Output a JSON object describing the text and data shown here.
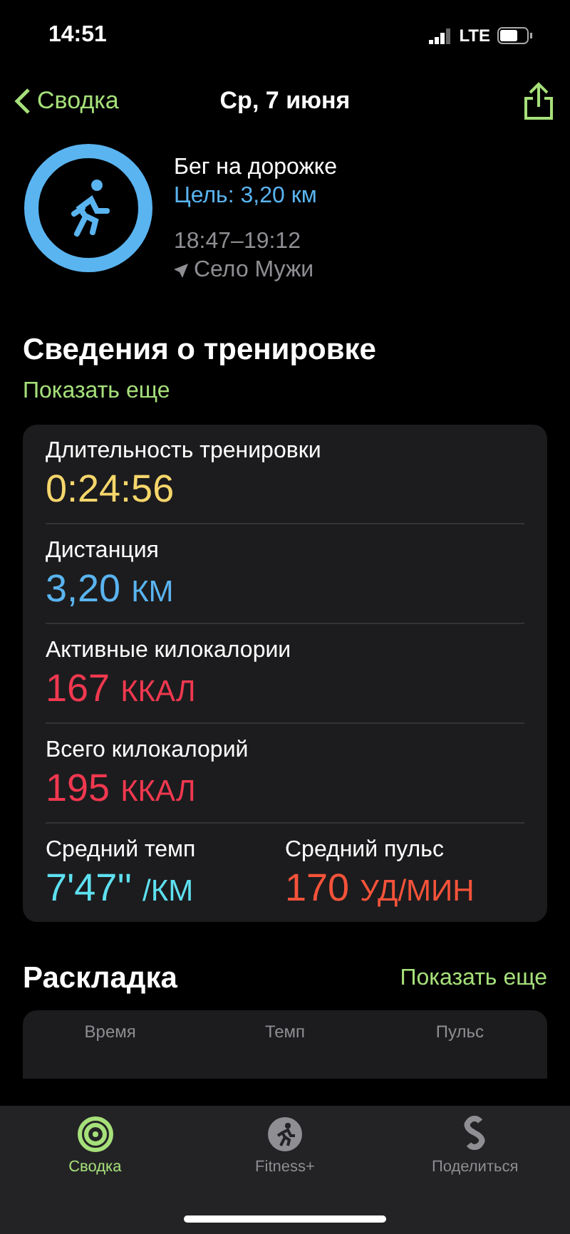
{
  "status_bar": {
    "time": "14:51",
    "network": "LTE"
  },
  "nav": {
    "back": "Сводка",
    "title": "Ср, 7 июня"
  },
  "workout": {
    "name": "Бег на дорожке",
    "goal": "Цель: 3,20 км",
    "goal_ring": {
      "level": 1
    },
    "time": "18:47–19:12",
    "location": "Село Мужи"
  },
  "details": {
    "title": "Сведения о тренировке",
    "show_more": "Показать еще",
    "rows": [
      {
        "items": [
          {
            "label": "Длительность тренировки",
            "value": "0:24:56",
            "color": "#f5d66b"
          }
        ]
      },
      {
        "items": [
          {
            "label": "Дистанция",
            "value": "3,20",
            "unit": "КМ",
            "color": "#5ab4f0"
          }
        ]
      },
      {
        "items": [
          {
            "label": "Активные килокалории",
            "value": "167",
            "unit": "ККАЛ",
            "color": "#f0384f"
          }
        ]
      },
      {
        "items": [
          {
            "label": "Всего килокалорий",
            "value": "195",
            "unit": "ККАЛ",
            "color": "#f0384f"
          }
        ]
      },
      {
        "items": [
          {
            "label": "Средний темп",
            "value": "7'47''",
            "unit": "/КМ",
            "color": "#5ee0f0"
          },
          {
            "label": "Средний пульс",
            "value": "170",
            "unit": "УД/МИН",
            "color": "#f5533a"
          }
        ]
      }
    ]
  },
  "splits": {
    "title": "Раскладка",
    "show_more": "Показать еще",
    "columns": [
      "Время",
      "Темп",
      "Пульс"
    ]
  },
  "tabs": [
    {
      "label": "Сводка",
      "kind": "rings",
      "selected": true
    },
    {
      "label": "Fitness+",
      "kind": "runner",
      "selected": false
    },
    {
      "label": "Поделиться",
      "kind": "share",
      "selected": false
    }
  ]
}
